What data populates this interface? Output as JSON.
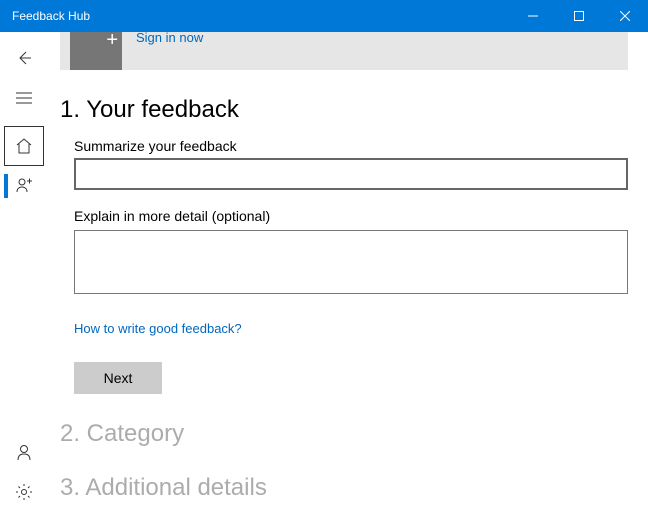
{
  "titlebar": {
    "title": "Feedback Hub"
  },
  "banner": {
    "signin": "Sign in now"
  },
  "step1": {
    "heading": "1. Your feedback",
    "summary_label": "Summarize your feedback",
    "summary_value": "",
    "detail_label": "Explain in more detail (optional)",
    "detail_value": "",
    "help_link": "How to write good feedback?",
    "next_label": "Next"
  },
  "step2": {
    "heading": "2. Category"
  },
  "step3": {
    "heading": "3. Additional details"
  }
}
